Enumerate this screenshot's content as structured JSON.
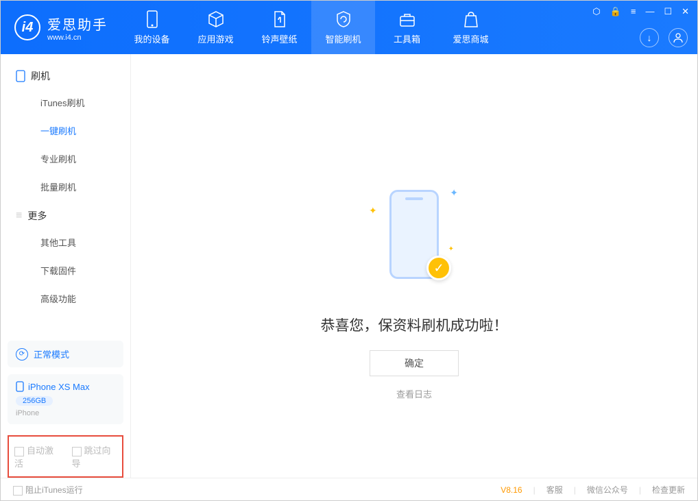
{
  "brand": {
    "name": "爱思助手",
    "site": "www.i4.cn"
  },
  "nav": {
    "items": [
      {
        "label": "我的设备"
      },
      {
        "label": "应用游戏"
      },
      {
        "label": "铃声壁纸"
      },
      {
        "label": "智能刷机"
      },
      {
        "label": "工具箱"
      },
      {
        "label": "爱思商城"
      }
    ]
  },
  "sidebar": {
    "group1": "刷机",
    "items1": [
      "iTunes刷机",
      "一键刷机",
      "专业刷机",
      "批量刷机"
    ],
    "group2": "更多",
    "items2": [
      "其他工具",
      "下载固件",
      "高级功能"
    ]
  },
  "device": {
    "mode": "正常模式",
    "name": "iPhone XS Max",
    "capacity": "256GB",
    "type": "iPhone"
  },
  "options": {
    "auto_activate": "自动激活",
    "skip_guide": "跳过向导"
  },
  "main": {
    "success": "恭喜您，保资料刷机成功啦！",
    "ok": "确定",
    "view_log": "查看日志"
  },
  "footer": {
    "block_itunes": "阻止iTunes运行",
    "version": "V8.16",
    "service": "客服",
    "wechat": "微信公众号",
    "update": "检查更新"
  }
}
